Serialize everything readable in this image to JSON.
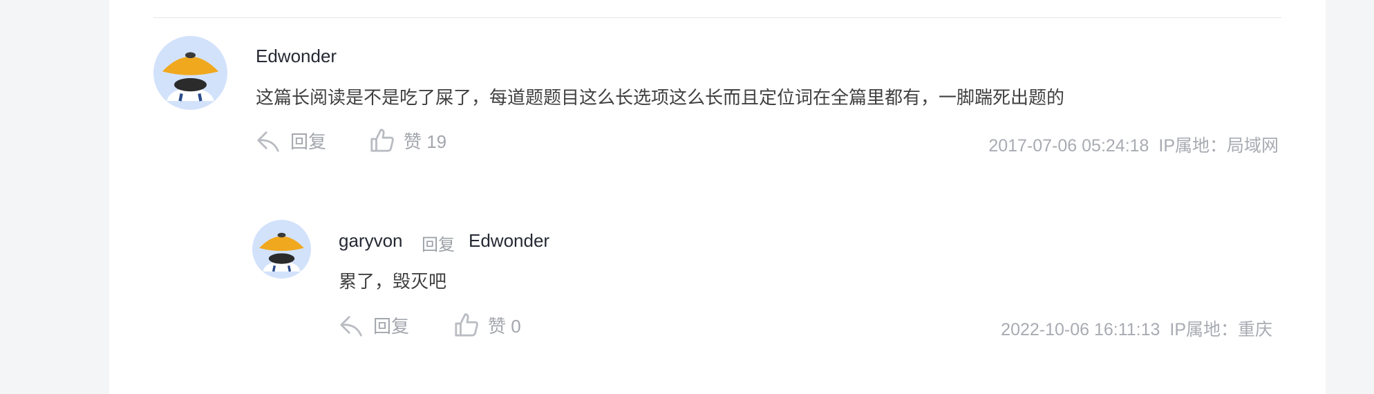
{
  "comments": [
    {
      "username": "Edwonder",
      "avatar_icon": "straw-hat-avatar",
      "content": "这篇长阅读是不是吃了屎了，每道题题目这么长选项这么长而且定位词在全篇里都有，一脚踹死出题的",
      "reply_label": "回复",
      "like_label": "赞 19",
      "timestamp": "2017-07-06 05:24:18",
      "ip_location": "IP属地：局域网"
    },
    {
      "username": "garyvon",
      "reply_word": "回复",
      "reply_target": "Edwonder",
      "avatar_icon": "straw-hat-avatar",
      "content": "累了，毁灭吧",
      "reply_label": "回复",
      "like_label": "赞 0",
      "timestamp": "2022-10-06 16:11:13",
      "ip_location": "IP属地：重庆"
    }
  ],
  "colors": {
    "avatar_bg": "#d3e2fb",
    "hat": "#f0a81e",
    "text_muted": "#a3a6ad"
  }
}
